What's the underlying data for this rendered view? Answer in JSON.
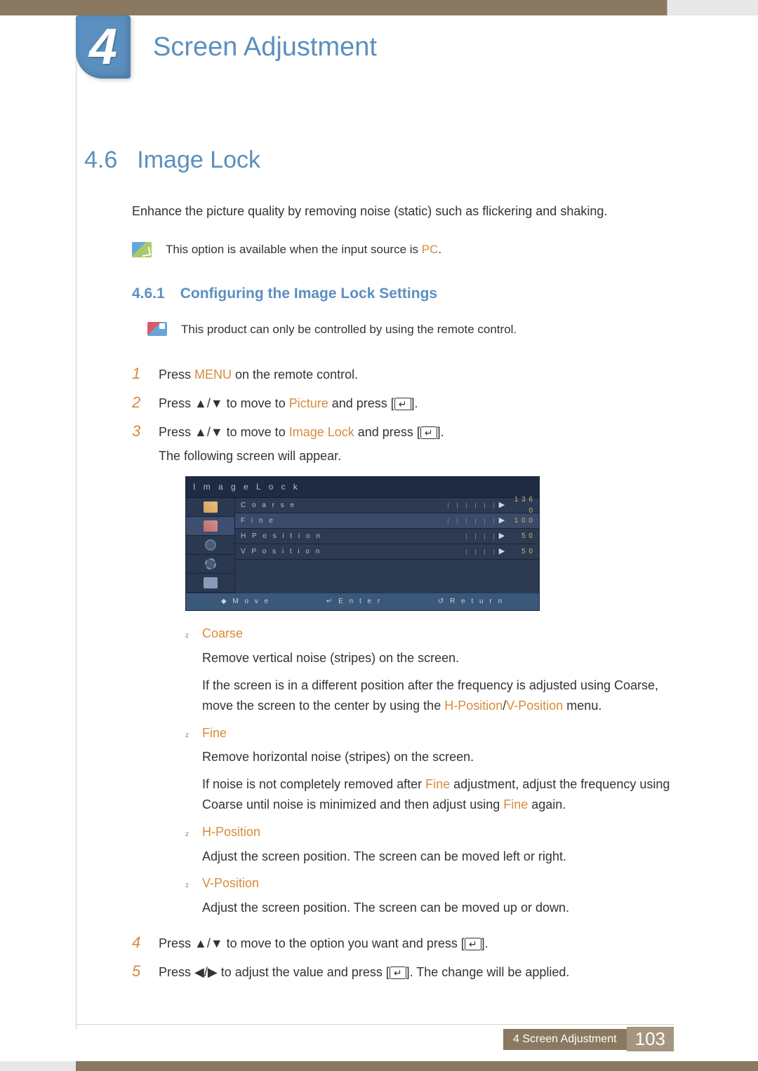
{
  "chapter": {
    "number": "4",
    "title": "Screen Adjustment"
  },
  "section": {
    "number": "4.6",
    "title": "Image Lock"
  },
  "intro": "Enhance the picture quality by removing noise (static) such as flickering and shaking.",
  "note1": {
    "prefix": "This option is available when the input source is ",
    "hl": "PC",
    "suffix": "."
  },
  "subsection": {
    "number": "4.6.1",
    "title": "Configuring the Image Lock Settings"
  },
  "note2": "This product can only be controlled by using the remote control.",
  "steps": {
    "s1": {
      "num": "1",
      "t1": "Press ",
      "hl1": "MENU",
      "t2": " on the remote control."
    },
    "s2": {
      "num": "2",
      "t1": "Press ",
      "arrows": "▲/▼",
      "t2": " to move to ",
      "hl1": "Picture",
      "t3": " and press [",
      "enter": "↵",
      "t4": "]."
    },
    "s3": {
      "num": "3",
      "t1": "Press ",
      "arrows": "▲/▼",
      "t2": " to move to ",
      "hl1": "Image Lock",
      "t3": " and press [",
      "enter": "↵",
      "t4": "].",
      "sub": "The following screen will appear."
    },
    "s4": {
      "num": "4",
      "t1": "Press ",
      "arrows": "▲/▼",
      "t2": " to move to the option you want and press [",
      "enter": "↵",
      "t3": "]."
    },
    "s5": {
      "num": "5",
      "t1": "Press ",
      "arrows": "◀/▶",
      "t2": " to adjust the value and press [",
      "enter": "↵",
      "t3": "]. The change will be applied."
    }
  },
  "osd": {
    "title": "I m a g e  L o c k",
    "rows": {
      "coarse": {
        "label": "C o a r s e",
        "value": "1 3 6 0"
      },
      "fine": {
        "label": "F i n e",
        "value": "1 0 0"
      },
      "hpos": {
        "label": "H  P o s i t i o n",
        "value": "5 0"
      },
      "vpos": {
        "label": "V  P o s i t i o n",
        "value": "5 0"
      }
    },
    "footer": {
      "move": "M o v e",
      "enter": "E n t e r",
      "return": "R e t u r n"
    }
  },
  "bullets": {
    "coarse": {
      "title": "Coarse",
      "p1": "Remove vertical noise (stripes) on the screen.",
      "p2a": "If the screen is in a different position after the frequency is adjusted using Coarse, move the screen to the center by using the ",
      "hpos": "H-Position",
      "slash": "/",
      "vpos": "V-Position",
      "p2b": " menu."
    },
    "fine": {
      "title": "Fine",
      "p1": "Remove horizontal noise (stripes) on the screen.",
      "p2a": "If noise is not completely removed after ",
      "hl1": "Fine",
      "p2b": " adjustment, adjust the frequency using Coarse until noise is minimized and then adjust using ",
      "hl2": "Fine",
      "p2c": " again."
    },
    "hpos": {
      "title": "H-Position",
      "p1": "Adjust the screen position. The screen can be moved left or right."
    },
    "vpos": {
      "title": "V-Position",
      "p1": "Adjust the screen position. The screen can be moved up or down."
    }
  },
  "footer": {
    "label": "4 Screen Adjustment",
    "page": "103"
  },
  "glyph": {
    "bullet": "z",
    "enter": "↵",
    "updown": "◆"
  }
}
